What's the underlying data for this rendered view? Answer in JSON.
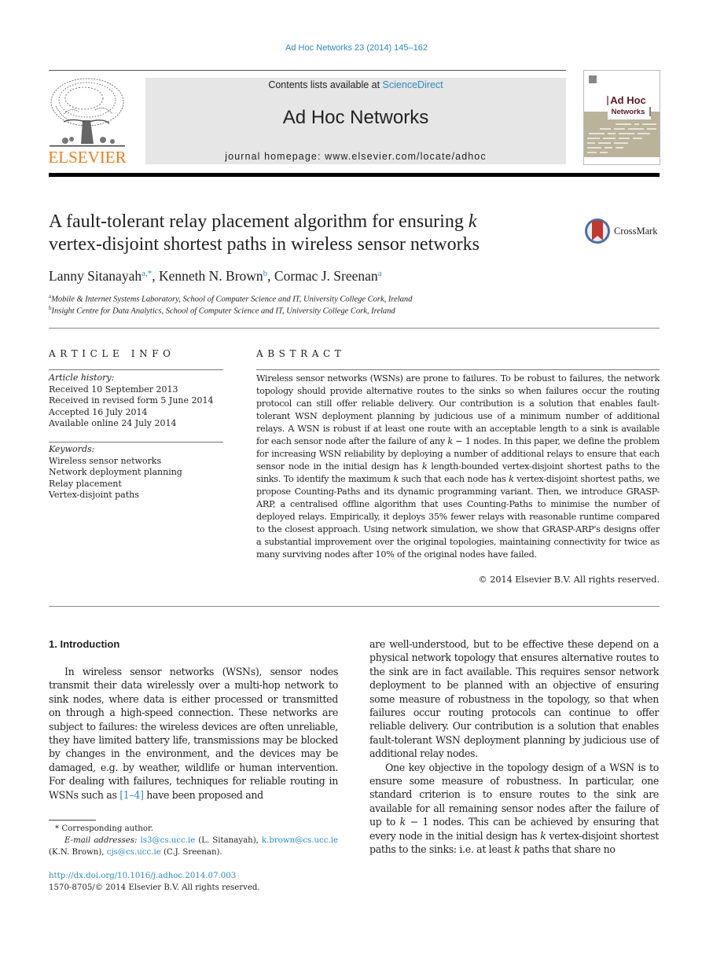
{
  "journal_ref": "Ad Hoc Networks 23 (2014) 145–162",
  "header": {
    "publisher_logo_text": "ELSEVIER",
    "contents_prefix": "Contents lists available at ",
    "contents_link": "ScienceDirect",
    "journal_name": "Ad Hoc Networks",
    "homepage_line": "journal homepage: www.elsevier.com/locate/adhoc",
    "cover_title_line1": "Ad Hoc",
    "cover_title_line2": "Networks"
  },
  "title": {
    "part1": "A fault-tolerant relay placement algorithm for ensuring ",
    "k": "k",
    "part2": "vertex-disjoint shortest paths in wireless sensor networks"
  },
  "crossmark_label": "CrossMark",
  "authors": [
    {
      "name": "Lanny Sitanayah",
      "sup": "a,*",
      "sep": ", "
    },
    {
      "name": "Kenneth N. Brown",
      "sup": "b",
      "sep": ", "
    },
    {
      "name": "Cormac J. Sreenan",
      "sup": "a",
      "sep": ""
    }
  ],
  "affiliations": [
    {
      "sup": "a",
      "text": "Mobile & Internet Systems Laboratory, School of Computer Science and IT, University College Cork, Ireland"
    },
    {
      "sup": "b",
      "text": "Insight Centre for Data Analytics, School of Computer Science and IT, University College Cork, Ireland"
    }
  ],
  "article_info": {
    "heading": "ARTICLE INFO",
    "history_label": "Article history:",
    "history": [
      "Received 10 September 2013",
      "Received in revised form 5 June 2014",
      "Accepted 16 July 2014",
      "Available online 24 July 2014"
    ],
    "keywords_label": "Keywords:",
    "keywords": [
      "Wireless sensor networks",
      "Network deployment planning",
      "Relay placement",
      "Vertex-disjoint paths"
    ]
  },
  "abstract": {
    "heading": "ABSTRACT",
    "s1": "Wireless sensor networks (WSNs) are prone to failures. To be robust to failures, the network topology should provide alternative routes to the sinks so when failures occur the routing protocol can still offer reliable delivery. Our contribution is a solution that enables fault-tolerant WSN deployment planning by judicious use of a minimum number of additional relays. A WSN is robust if at least one route with an acceptable length to a sink is available for each sensor node after the failure of any ",
    "s2": " − 1 nodes. In this paper, we define the problem for increasing WSN reliability by deploying a number of additional relays to ensure that each sensor node in the initial design has ",
    "s3": " length-bounded vertex-disjoint shortest paths to the sinks. To identify the maximum ",
    "s4": " such that each node has ",
    "s5": " vertex-disjoint shortest paths, we propose Counting-Paths and its dynamic programming variant. Then, we introduce GRASP-ARP, a centralised offline algorithm that uses Counting-Paths to minimise the number of deployed relays. Empirically, it deploys 35% fewer relays with reasonable runtime compared to the closest approach. Using network simulation, we show that GRASP-ARP's designs offer a substantial improvement over the original topologies, maintaining connectivity for twice as many surviving nodes after 10% of the original nodes have failed.",
    "k": "k",
    "copyright": "© 2014 Elsevier B.V. All rights reserved."
  },
  "body": {
    "section_heading": "1. Introduction",
    "left_p1_a": "In wireless sensor networks (WSNs), sensor nodes transmit their data wirelessly over a multi-hop network to sink nodes, where data is either processed or transmitted on through a high-speed connection. These networks are subject to failures: the wireless devices are often unreliable, they have limited battery life, transmissions may be blocked by changes in the environment, and the devices may be damaged, e.g. by weather, wildlife or human intervention. For dealing with failures, techniques for reliable routing in WSNs such as ",
    "left_p1_cite": "[1–4]",
    "left_p1_b": " have been proposed and",
    "right_p1": "are well-understood, but to be effective these depend on a physical network topology that ensures alternative routes to the sink are in fact available. This requires sensor network deployment to be planned with an objective of ensuring some measure of robustness in the topology, so that when failures occur routing protocols can continue to offer reliable delivery. Our contribution is a solution that enables fault-tolerant WSN deployment planning by judicious use of additional relay nodes.",
    "right_p2_a": "One key objective in the topology design of a WSN is to ensure some measure of robustness. In particular, one standard criterion is to ensure routes to the sink are available for all remaining sensor nodes after the failure of up to ",
    "right_p2_b": " − 1 nodes. This can be achieved by ensuring that every node in the initial design has ",
    "right_p2_c": " vertex-disjoint shortest paths to the sinks: i.e. at least ",
    "right_p2_d": " paths that share no",
    "k": "k"
  },
  "footnotes": {
    "corresponding": "* Corresponding author.",
    "email_label": "E-mail addresses:",
    "emails": [
      {
        "addr": "ls3@cs.ucc.ie",
        "who": " (L. Sitanayah), "
      },
      {
        "addr": "k.brown@cs.ucc.ie",
        "who": " (K.N. Brown), "
      },
      {
        "addr": "cjs@cs.ucc.ie",
        "who": " (C.J. Sreenan)."
      }
    ],
    "doi": "http://dx.doi.org/10.1016/j.adhoc.2014.07.003",
    "issn_line": "1570-8705/© 2014 Elsevier B.V. All rights reserved."
  },
  "colors": {
    "link": "#2a8bbf",
    "elsevier_orange": "#f07d1a",
    "header_band": "#e6e6e6",
    "cover_olive": "#b9b39a",
    "cover_maroon": "#5a1a2a",
    "crossmark_red": "#c0392b",
    "crossmark_blue": "#4a6fa5"
  }
}
